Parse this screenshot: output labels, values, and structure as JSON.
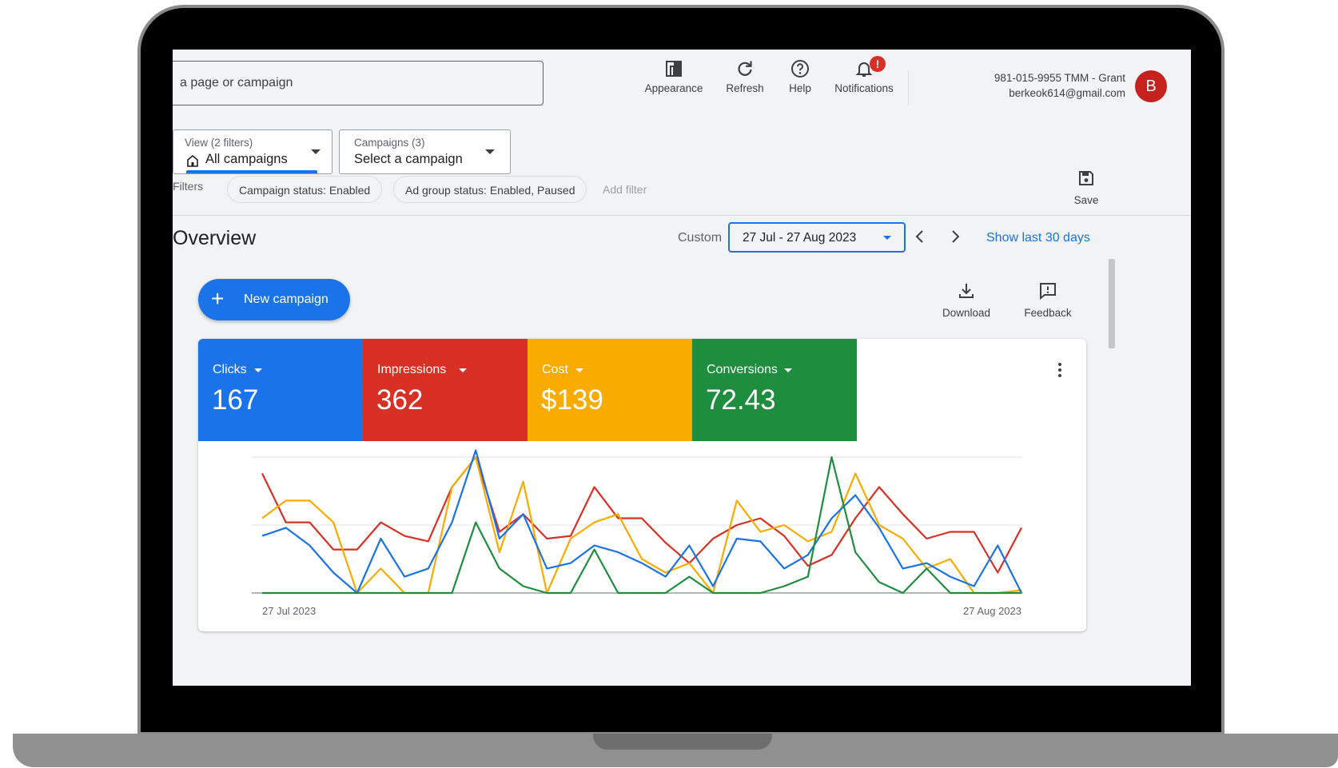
{
  "header": {
    "search_placeholder": "a page or campaign",
    "tools": [
      {
        "label": "Appearance",
        "icon": "appearance-icon"
      },
      {
        "label": "Refresh",
        "icon": "refresh-icon"
      },
      {
        "label": "Help",
        "icon": "help-icon"
      },
      {
        "label": "Notifications",
        "icon": "notifications-icon",
        "badge": "!"
      }
    ],
    "account_id": "981-015-9955 TMM - Grant",
    "account_email": "berkeok614@gmail.com",
    "avatar_letter": "B"
  },
  "selectors": {
    "view": {
      "label": "View (2 filters)",
      "value": "All campaigns",
      "icon": "building-icon"
    },
    "campaigns": {
      "label": "Campaigns (3)",
      "value": "Select a campaign"
    }
  },
  "filters": {
    "label": "Filters",
    "chips": [
      "Campaign status: Enabled",
      "Ad group status: Enabled, Paused"
    ],
    "add_filter": "Add filter"
  },
  "save_label": "Save",
  "overview": {
    "title": "Overview",
    "custom_label": "Custom",
    "date_range": "27 Jul - 27 Aug 2023",
    "show_last": "Show last 30 days",
    "new_campaign": "New campaign",
    "download": "Download",
    "feedback": "Feedback"
  },
  "metrics": [
    {
      "label": "Clicks",
      "value": "167",
      "color": "#1a73e8"
    },
    {
      "label": "Impressions",
      "value": "362",
      "color": "#d93025"
    },
    {
      "label": "Cost",
      "value": "$139",
      "color": "#f9ab00"
    },
    {
      "label": "Conversions",
      "value": "72.43",
      "color": "#1e8e3e"
    }
  ],
  "colors": {
    "accent": "#1a73e8",
    "avatar": "#c5221f",
    "badge": "#d93025"
  },
  "chart_data": {
    "type": "line",
    "x_start_label": "27 Jul 2023",
    "x_end_label": "27 Aug 2023",
    "ylim": [
      0,
      100
    ],
    "grid": true,
    "series": [
      {
        "name": "Impressions",
        "color": "#d93025",
        "values": [
          88,
          52,
          52,
          32,
          32,
          52,
          42,
          38,
          78,
          100,
          45,
          58,
          40,
          42,
          78,
          55,
          55,
          37,
          22,
          40,
          50,
          55,
          42,
          20,
          28,
          55,
          78,
          58,
          40,
          45,
          45,
          15,
          48
        ]
      },
      {
        "name": "Cost",
        "color": "#f9ab00",
        "values": [
          55,
          68,
          68,
          52,
          0,
          18,
          0,
          0,
          78,
          100,
          30,
          82,
          0,
          40,
          52,
          58,
          25,
          15,
          22,
          0,
          68,
          45,
          50,
          38,
          45,
          88,
          50,
          40,
          18,
          25,
          0,
          0,
          2
        ]
      },
      {
        "name": "Clicks",
        "color": "#1a73e8",
        "values": [
          42,
          48,
          35,
          15,
          0,
          40,
          12,
          18,
          52,
          105,
          40,
          58,
          18,
          22,
          35,
          30,
          22,
          12,
          35,
          5,
          40,
          38,
          18,
          28,
          55,
          72,
          48,
          18,
          22,
          12,
          5,
          35,
          0
        ]
      },
      {
        "name": "Conversions",
        "color": "#1e8e3e",
        "values": [
          0,
          0,
          0,
          0,
          0,
          0,
          0,
          0,
          0,
          52,
          18,
          5,
          0,
          0,
          32,
          0,
          0,
          0,
          12,
          0,
          0,
          0,
          5,
          12,
          100,
          30,
          8,
          0,
          18,
          0,
          0,
          0,
          0
        ]
      }
    ]
  }
}
